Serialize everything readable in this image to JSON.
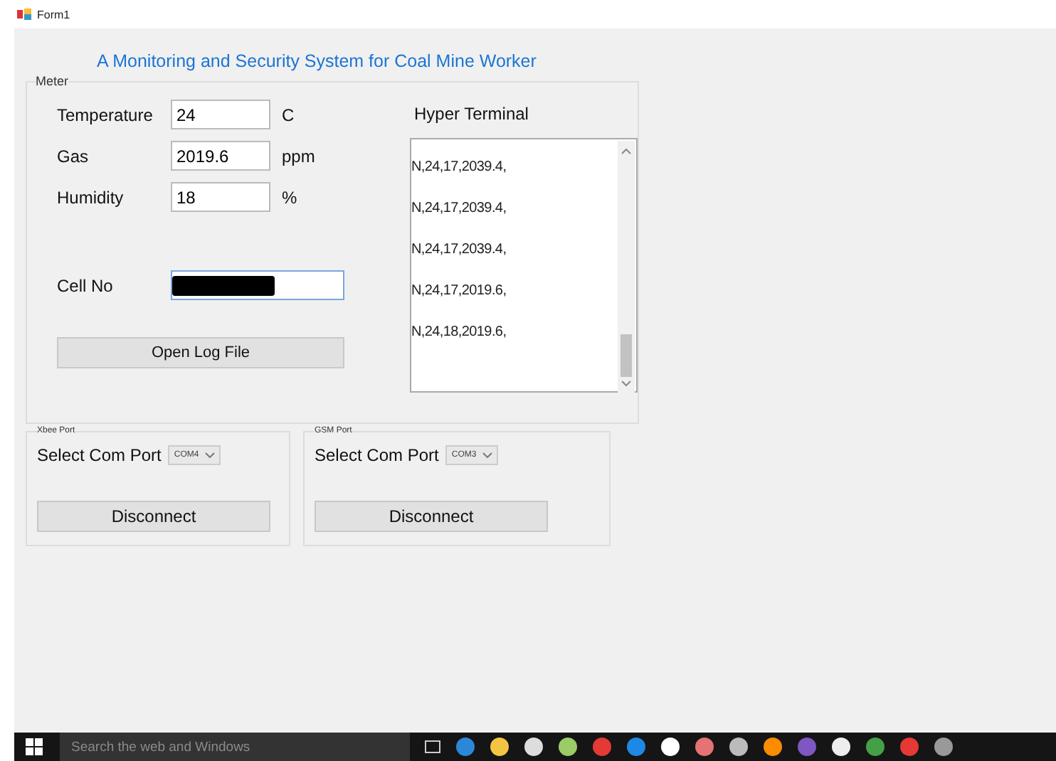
{
  "window": {
    "title": "Form1"
  },
  "heading": "A Monitoring and Security System for Coal Mine Worker",
  "meter": {
    "label": "Meter",
    "readings": [
      {
        "label": "Temperature",
        "value": "24",
        "unit": "C"
      },
      {
        "label": "Gas",
        "value": "2019.6",
        "unit": "ppm"
      },
      {
        "label": "Humidity",
        "value": "18",
        "unit": "%"
      }
    ],
    "cell": {
      "label": "Cell No",
      "redacted": true,
      "focused": true
    },
    "log_button": "Open Log File"
  },
  "terminal": {
    "label": "Hyper Terminal",
    "lines": [
      "N,24,17,2039.4,",
      "N,24,17,2039.4,",
      "N,24,17,2039.4,",
      "N,24,17,2019.6,",
      "N,24,18,2019.6,"
    ]
  },
  "ports": [
    {
      "label": "Xbee Port",
      "prompt": "Select Com Port",
      "port": "COM4",
      "button": "Disconnect"
    },
    {
      "label": "GSM Port",
      "prompt": "Select Com Port",
      "port": "COM3",
      "button": "Disconnect"
    }
  ],
  "taskbar": {
    "search_placeholder": "Search the web and Windows"
  }
}
